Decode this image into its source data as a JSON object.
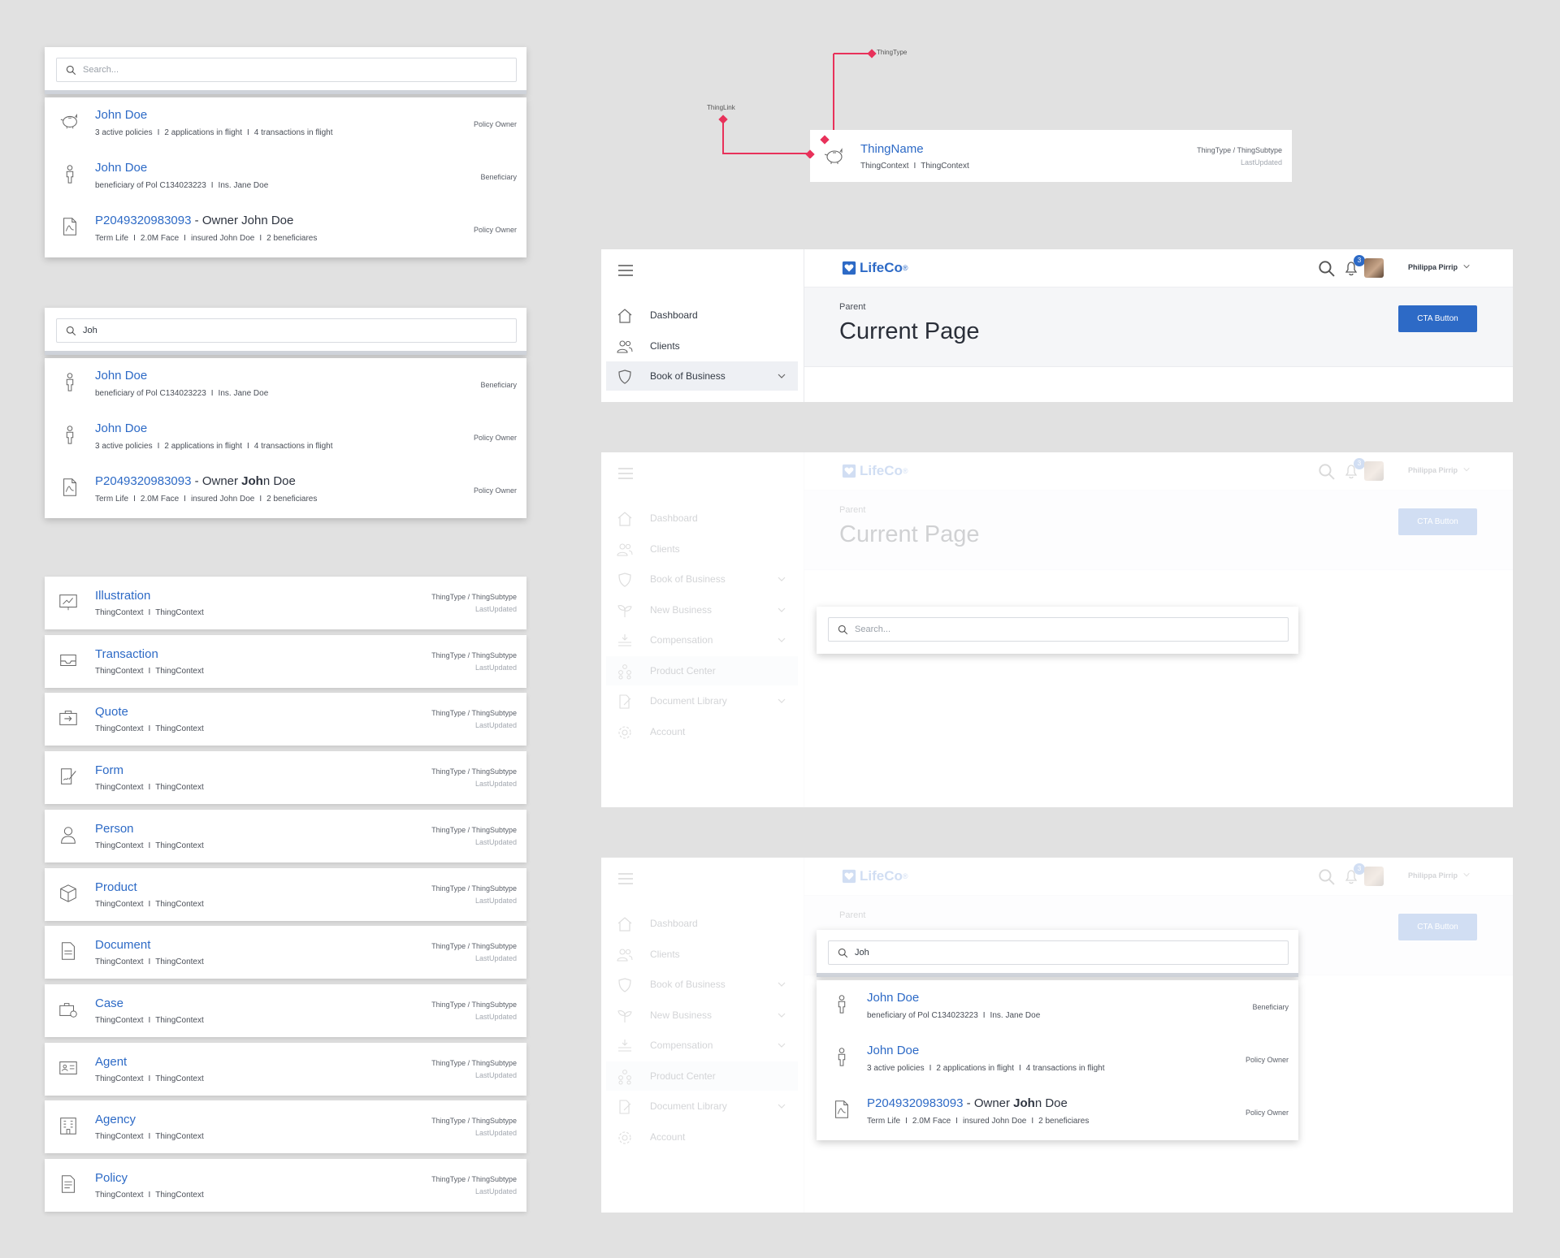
{
  "colors": {
    "accent": "#2d6ac6",
    "connector": "#e8315a",
    "background": "#e1e1e1"
  },
  "search_default": {
    "placeholder": "Search...",
    "results": [
      {
        "icon": "piggy-bank-icon",
        "name": "John Doe",
        "meta": [
          "3 active policies",
          "2 applications in flight",
          "4 transactions in flight"
        ],
        "role": "Policy Owner"
      },
      {
        "icon": "person-icon",
        "name": "John Doe",
        "meta": [
          "beneficiary of Pol C134023223",
          "Ins. Jane Doe"
        ],
        "role": "Beneficiary"
      },
      {
        "icon": "pdf-icon",
        "policy": "P2049320983093",
        "sep": " - ",
        "owner": "Owner John Doe",
        "meta": [
          "Term Life",
          "2.0M Face",
          "insured John Doe",
          "2 beneficiares"
        ],
        "role": "Policy Owner"
      }
    ]
  },
  "search_typed": {
    "query": "Joh",
    "results": [
      {
        "icon": "person-icon",
        "name_match": "John",
        "name_rest": " Doe",
        "meta": [
          "beneficiary of Pol C134023223",
          "Ins. Jane Doe"
        ],
        "role": "Beneficiary"
      },
      {
        "icon": "person-icon",
        "name_match": "John",
        "name_rest": " Doe",
        "meta": [
          "3 active policies",
          "2 applications in flight",
          "4 transactions in flight"
        ],
        "role": "Policy Owner"
      },
      {
        "icon": "pdf-icon",
        "policy": "P2049320983093",
        "sep": " - ",
        "owner_pre": "Owner ",
        "owner_match": "Joh",
        "owner_rest": "n Doe",
        "meta": [
          "Term Life",
          "2.0M Face",
          "insured John Doe",
          "2 beneficiares"
        ],
        "role": "Policy Owner"
      }
    ]
  },
  "thing_types": [
    {
      "icon": "illustration-icon",
      "title": "Illustration"
    },
    {
      "icon": "tray-icon",
      "title": "Transaction"
    },
    {
      "icon": "quote-icon",
      "title": "Quote"
    },
    {
      "icon": "form-icon",
      "title": "Form"
    },
    {
      "icon": "user-icon",
      "title": "Person"
    },
    {
      "icon": "cube-icon",
      "title": "Product"
    },
    {
      "icon": "document-icon",
      "title": "Document"
    },
    {
      "icon": "case-icon",
      "title": "Case"
    },
    {
      "icon": "id-card-icon",
      "title": "Agent"
    },
    {
      "icon": "building-icon",
      "title": "Agency"
    },
    {
      "icon": "policy-icon",
      "title": "Policy"
    }
  ],
  "thing_meta": {
    "context": "ThingContext",
    "context_sep": "I",
    "type": "ThingType / ThingSubtype",
    "updated": "LastUpdated"
  },
  "diagram": {
    "label_type": "ThingType",
    "label_link": "ThingLink",
    "thing_name": "ThingName",
    "context1": "ThingContext",
    "context2": "ThingContext",
    "type": "ThingType / ThingSubtype",
    "updated": "LastUpdated"
  },
  "app": {
    "logo": "LifeCo",
    "logo_reg": "®",
    "notifications": "3",
    "user": "Philippa Pirrip",
    "parent": "Parent",
    "title": "Current Page",
    "cta": "CTA Button",
    "nav": [
      {
        "label": "Dashboard",
        "icon": "home-icon"
      },
      {
        "label": "Clients",
        "icon": "users-icon"
      },
      {
        "label": "Book of Business",
        "icon": "shield-icon"
      },
      {
        "label": "New Business",
        "icon": "sprout-icon"
      },
      {
        "label": "Compensation",
        "icon": "money-icon"
      },
      {
        "label": "Product Center",
        "icon": "hierarchy-icon"
      },
      {
        "label": "Document Library",
        "icon": "doc-edit-icon"
      },
      {
        "label": "Account",
        "icon": "gear-icon"
      }
    ],
    "search_placeholder": "Search...",
    "search_query": "Joh"
  }
}
